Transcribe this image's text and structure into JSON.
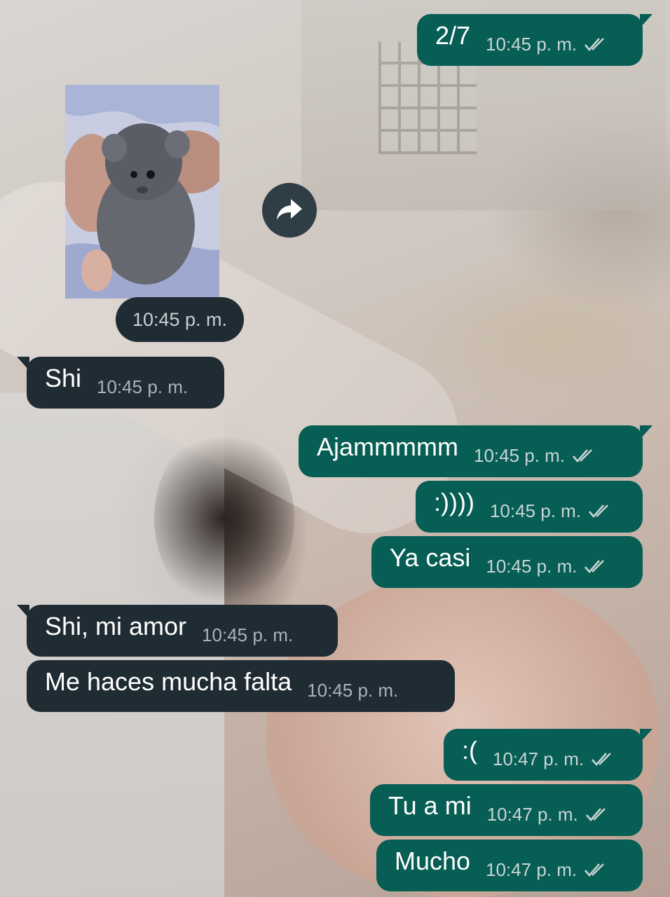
{
  "media_message": {
    "time": "10:45 p. m."
  },
  "messages": [
    {
      "dir": "out",
      "text": "2/7",
      "time": "10:45 p. m."
    },
    {
      "dir": "in",
      "text": "Shi",
      "time": "10:45 p. m."
    },
    {
      "dir": "out",
      "text": "Ajammmmm",
      "time": "10:45 p. m."
    },
    {
      "dir": "out",
      "text": ":))))",
      "time": "10:45 p. m."
    },
    {
      "dir": "out",
      "text": "Ya casi",
      "time": "10:45 p. m."
    },
    {
      "dir": "in",
      "text": "Shi, mi amor",
      "time": "10:45 p. m."
    },
    {
      "dir": "in",
      "text": "Me haces mucha falta",
      "time": "10:45 p. m."
    },
    {
      "dir": "out",
      "text": ":(",
      "time": "10:47 p. m."
    },
    {
      "dir": "out",
      "text": "Tu a mi",
      "time": "10:47 p. m."
    },
    {
      "dir": "out",
      "text": "Mucho",
      "time": "10:47 p. m."
    }
  ],
  "icons": {
    "read_receipt": "double-check-icon",
    "forward": "forward-icon"
  },
  "colors": {
    "outgoing_bubble": "#075e54",
    "incoming_bubble": "#1f2c34",
    "text": "#ffffff"
  }
}
